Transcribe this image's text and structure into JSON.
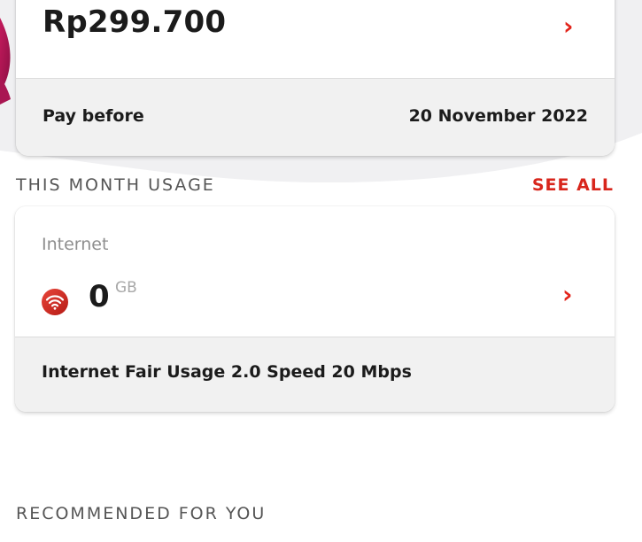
{
  "bill": {
    "amount": "Rp299.700",
    "pay_before_label": "Pay before",
    "pay_before_date": "20 November 2022"
  },
  "usage": {
    "section_title": "THIS MONTH USAGE",
    "see_all": "SEE ALL",
    "item_label": "Internet",
    "value": "0",
    "unit": "GB",
    "plan": "Internet Fair Usage 2.0 Speed 20 Mbps"
  },
  "recommended": {
    "section_title": "RECOMMENDED FOR YOU"
  },
  "icons": {
    "chevron": "chevron-right-icon",
    "wifi": "wifi-icon"
  },
  "colors": {
    "accent": "#e2231a",
    "wave_magenta": "#b0124e",
    "card_footer": "#f1f1f1"
  }
}
